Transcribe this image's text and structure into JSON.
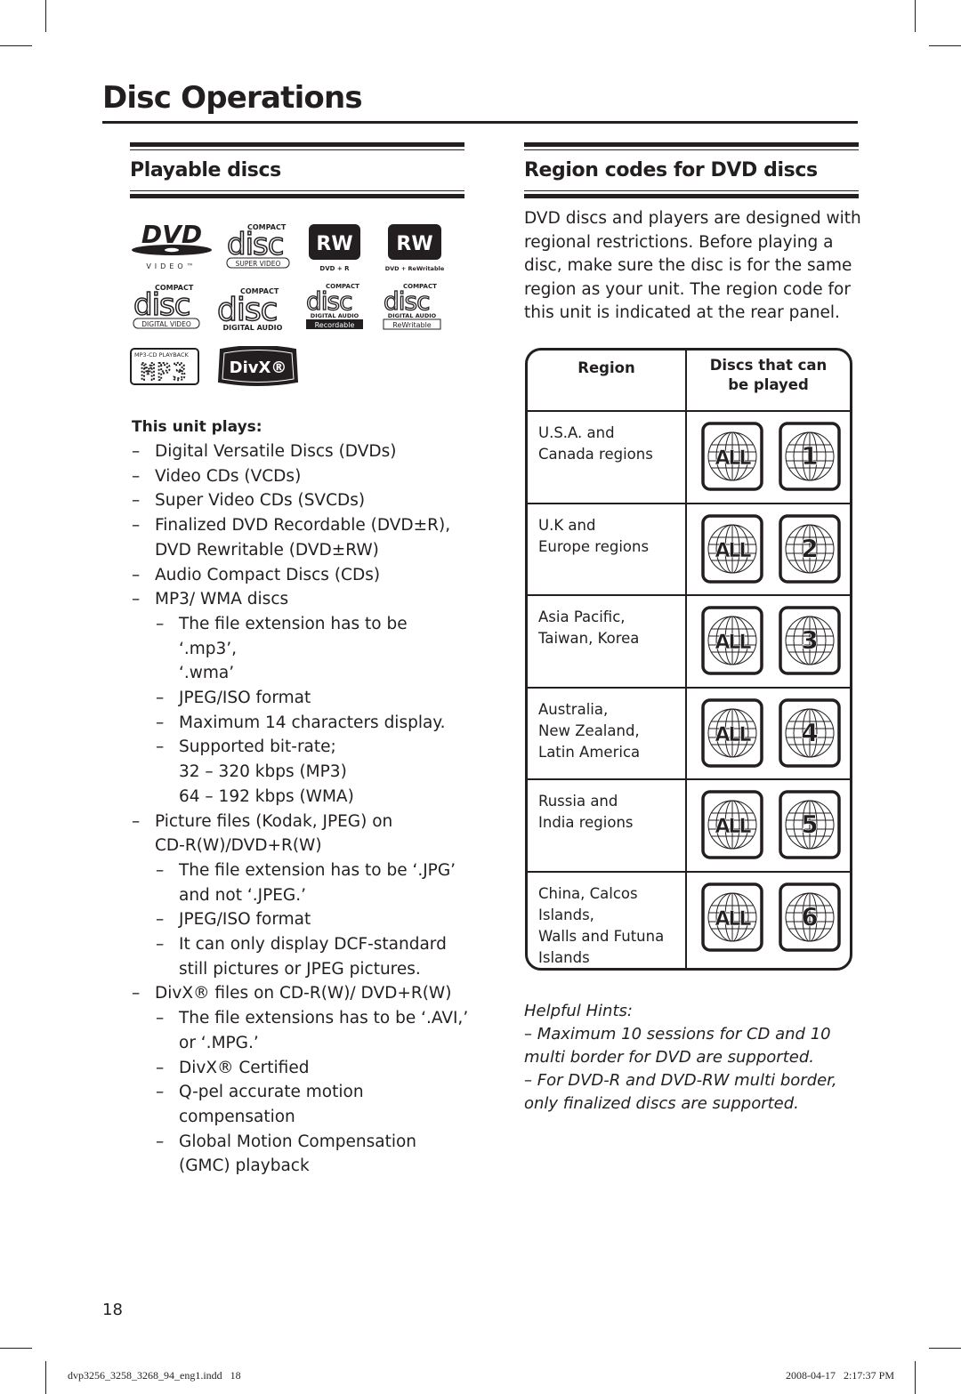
{
  "page": {
    "title": "Disc Operations",
    "page_number": "18"
  },
  "playable": {
    "heading": "Playable discs",
    "logos": [
      {
        "name": "dvd-video-logo",
        "main": "DVD",
        "sub": "VIDEO™"
      },
      {
        "name": "compact-disc-super-video-logo",
        "top": "COMPACT",
        "main": "disc",
        "sub": "SUPER VIDEO"
      },
      {
        "name": "dvd-plus-r-logo",
        "main": "RW",
        "sub": "DVD + R"
      },
      {
        "name": "dvd-plus-rewritable-logo",
        "main": "RW",
        "sub": "DVD + ReWritable"
      },
      {
        "name": "compact-disc-digital-video-logo",
        "top": "COMPACT",
        "main": "disc",
        "sub": "DIGITAL VIDEO"
      },
      {
        "name": "compact-disc-digital-audio-logo",
        "top": "COMPACT",
        "main": "disc",
        "sub": "DIGITAL AUDIO"
      },
      {
        "name": "compact-disc-recordable-logo",
        "top": "COMPACT",
        "main": "disc",
        "sub": "DIGITAL AUDIO",
        "sub2": "Recordable"
      },
      {
        "name": "compact-disc-rewritable-logo",
        "top": "COMPACT",
        "main": "disc",
        "sub": "DIGITAL AUDIO",
        "sub2": "ReWritable"
      },
      {
        "name": "mp3-cd-playback-logo",
        "top": "MP3-CD PLAYBACK",
        "main": "MP3"
      },
      {
        "name": "divx-logo",
        "main": "DivX®"
      }
    ],
    "plays_heading": "This unit plays:",
    "items": [
      {
        "level": 1,
        "text": "Digital Versatile Discs (DVDs)"
      },
      {
        "level": 1,
        "text": "Video CDs (VCDs)"
      },
      {
        "level": 1,
        "text": "Super Video CDs (SVCDs)"
      },
      {
        "level": 1,
        "text": "Finalized DVD Recordable (DVD±R),",
        "cont": "DVD Rewritable (DVD±RW)"
      },
      {
        "level": 1,
        "text": "Audio Compact Discs (CDs)"
      },
      {
        "level": 1,
        "text": "MP3/ WMA discs"
      },
      {
        "level": 2,
        "text": "The file extension has to be ‘.mp3’,",
        "cont": "‘.wma’"
      },
      {
        "level": 2,
        "text": "JPEG/ISO format"
      },
      {
        "level": 2,
        "text": "Maximum 14 characters display."
      },
      {
        "level": 2,
        "text": "Supported bit-rate;",
        "cont": "32 – 320 kbps (MP3)",
        "cont_b": "64 – 192 kbps (WMA)"
      },
      {
        "level": 1,
        "text": "Picture files (Kodak, JPEG) on",
        "cont": "CD-R(W)/DVD+R(W)"
      },
      {
        "level": 2,
        "text": "The file extension has to be ‘.JPG’",
        "cont": "and not ‘.JPEG.’"
      },
      {
        "level": 2,
        "text": "JPEG/ISO format"
      },
      {
        "level": 2,
        "text": "It can only display DCF-standard",
        "cont": "still pictures or JPEG pictures."
      },
      {
        "level": 1,
        "text": "DivX® files on CD-R(W)/ DVD+R(W)"
      },
      {
        "level": 2,
        "text": "The file extensions has to be ‘.AVI,’",
        "cont": "or ‘.MPG.’"
      },
      {
        "level": 2,
        "text": "DivX® Certified"
      },
      {
        "level": 2,
        "text": "Q-pel accurate motion",
        "cont": "compensation"
      },
      {
        "level": 2,
        "text": "Global Motion Compensation",
        "cont": "(GMC) playback"
      }
    ],
    "dash": "–"
  },
  "region": {
    "heading": "Region codes for DVD discs",
    "intro": "DVD discs and players are designed with regional restrictions. Before playing a disc, make sure the disc is for the same region as your unit. The region code for this unit is indicated at the rear panel.",
    "table": {
      "col_region": "Region",
      "col_discs_line1": "Discs that can",
      "col_discs_line2": "be played",
      "rows": [
        {
          "region_lines": [
            "U.S.A. and",
            "Canada regions"
          ],
          "codes": [
            "ALL",
            "1"
          ]
        },
        {
          "region_lines": [
            "U.K and",
            "Europe regions"
          ],
          "codes": [
            "ALL",
            "2"
          ]
        },
        {
          "region_lines": [
            "Asia Pacific,",
            "Taiwan, Korea"
          ],
          "codes": [
            "ALL",
            "3"
          ]
        },
        {
          "region_lines": [
            "Australia,",
            "New Zealand,",
            "Latin America"
          ],
          "codes": [
            "ALL",
            "4"
          ]
        },
        {
          "region_lines": [
            "Russia and",
            "India regions"
          ],
          "codes": [
            "ALL",
            "5"
          ]
        },
        {
          "region_lines": [
            "China, Calcos",
            "Islands,",
            "Walls and Futuna",
            "Islands"
          ],
          "codes": [
            "ALL",
            "6"
          ]
        }
      ]
    },
    "hints_title": "Helpful Hints:",
    "hints": [
      "–  Maximum 10 sessions for CD and 10 multi border for DVD are supported.",
      "–  For DVD-R and DVD-RW multi border, only finalized discs are supported."
    ]
  },
  "footer": {
    "file": "dvp3256_3258_3268_94_eng1.indd   18",
    "timestamp": "2008-04-17   2:17:37 PM"
  }
}
